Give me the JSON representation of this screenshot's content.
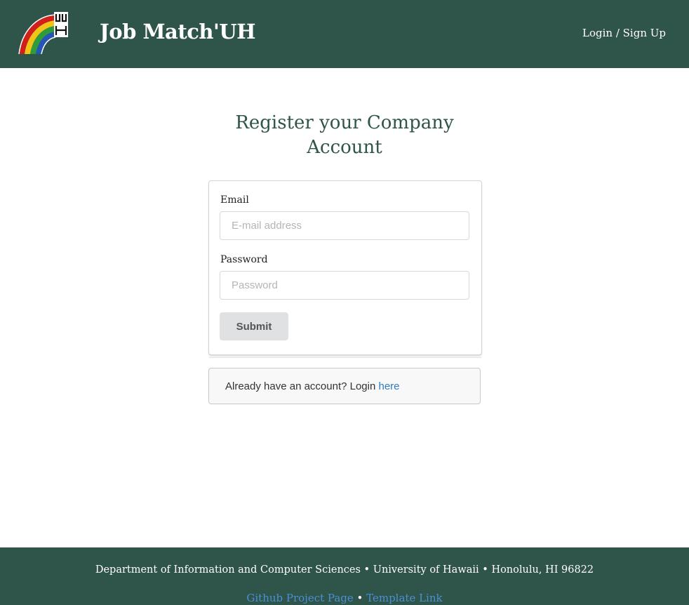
{
  "header": {
    "logo_name": "uh-rainbow-logo",
    "brand": "Job Match'UH",
    "login_link": "Login / Sign Up"
  },
  "page": {
    "title_line1": "Register your Company",
    "title_line2": "Account"
  },
  "form": {
    "email_label": "Email",
    "email_placeholder": "E-mail address",
    "email_value": "",
    "password_label": "Password",
    "password_placeholder": "Password",
    "password_value": "",
    "submit_label": "Submit"
  },
  "message": {
    "text": "Already have an account? Login ",
    "link_text": "here"
  },
  "footer": {
    "department": "Department of Information and Computer Sciences",
    "university": "University of Hawaii",
    "location": "Honolulu, HI 96822",
    "separator": " • ",
    "github_link": "Github Project Page",
    "template_link": "Template Link"
  },
  "colors": {
    "header_bg": "#2f5449",
    "title_color": "#2f5449",
    "link_color": "#2f7bc0"
  }
}
